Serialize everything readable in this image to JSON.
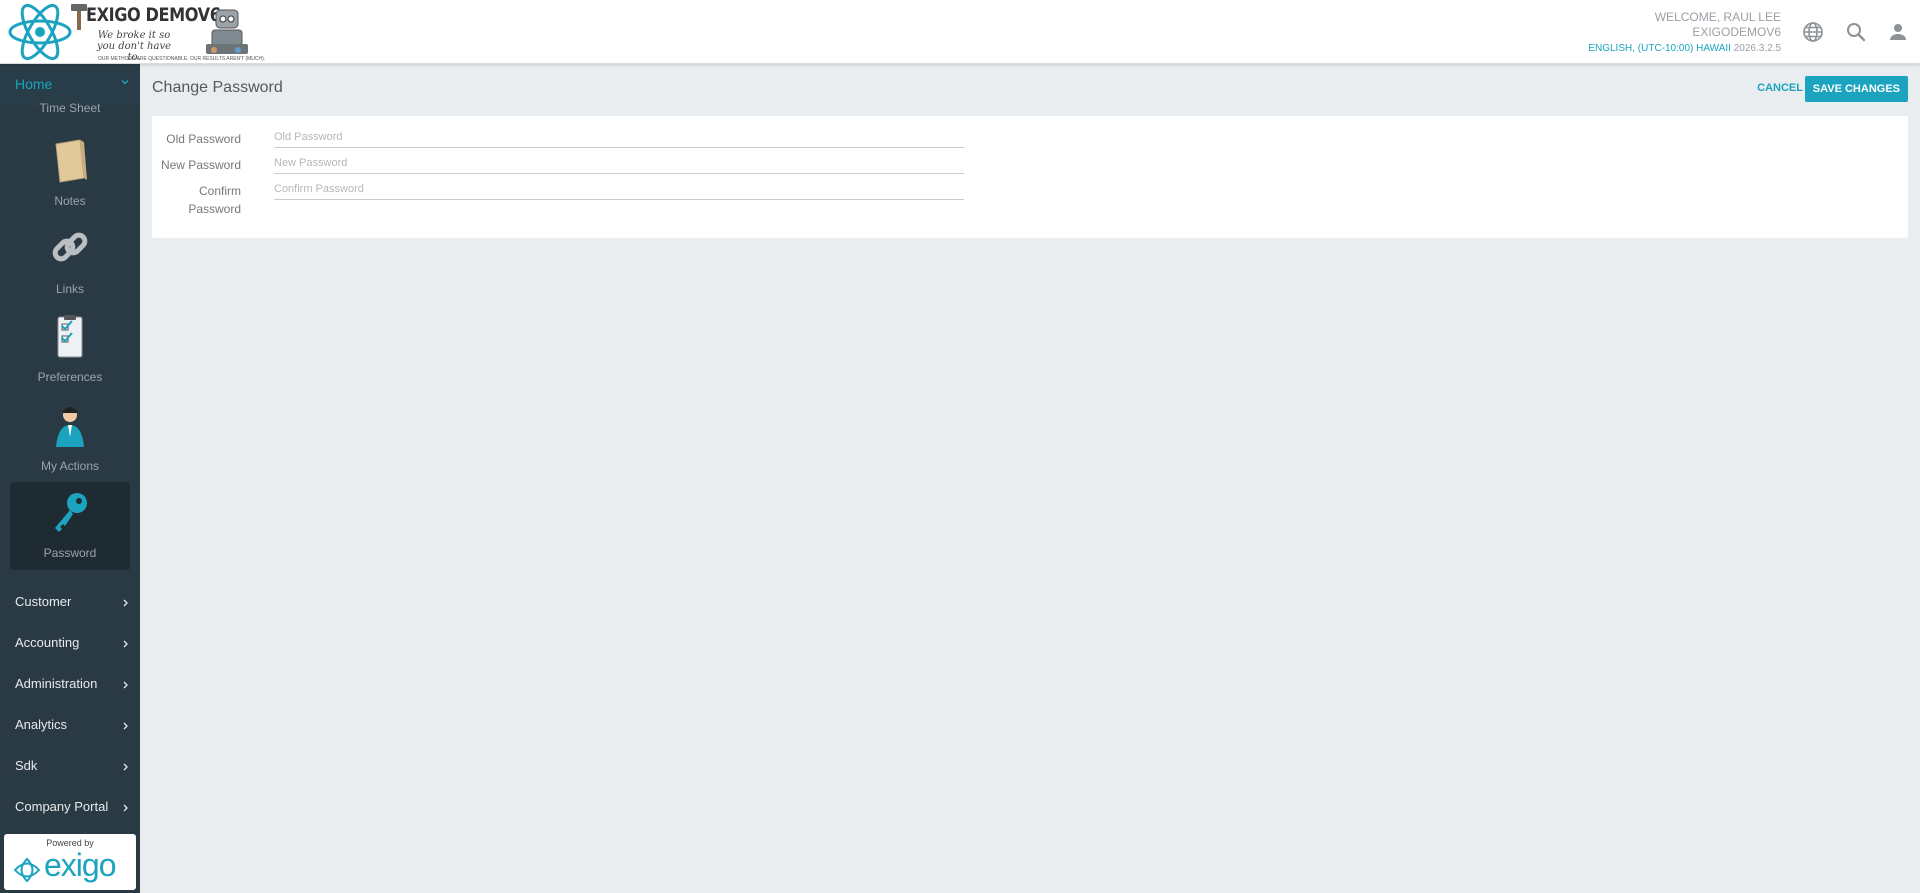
{
  "header": {
    "logo_title": "EXIGO DEMOV6",
    "logo_tagline": "We broke it so you don't have to.",
    "logo_fine_print": "OUR METHODS ARE QUESTIONABLE. OUR RESULTS AREN'T (MUCH).",
    "welcome": "WELCOME, RAUL LEE",
    "company": "EXIGODEMOV6",
    "locale": "ENGLISH, (UTC-10:00) HAWAII",
    "version": "2026.3.2.5",
    "icons": [
      "globe-icon",
      "search-icon",
      "user-icon"
    ]
  },
  "sidebar": {
    "home_label": "Home",
    "partial_caption": "Time Sheet",
    "apps": [
      {
        "label": "Notes",
        "icon": "notes-icon"
      },
      {
        "label": "Links",
        "icon": "links-icon"
      },
      {
        "label": "Preferences",
        "icon": "preferences-icon"
      },
      {
        "label": "My Actions",
        "icon": "my-actions-icon"
      },
      {
        "label": "Password",
        "icon": "key-icon",
        "active": true
      }
    ],
    "nav": [
      {
        "label": "Customer"
      },
      {
        "label": "Accounting"
      },
      {
        "label": "Administration"
      },
      {
        "label": "Analytics"
      },
      {
        "label": "Sdk"
      },
      {
        "label": "Company Portal"
      }
    ],
    "powered_by": "Powered by",
    "brand": "exigo"
  },
  "main": {
    "title": "Change Password",
    "cancel_label": "CANCEL",
    "save_label": "SAVE CHANGES",
    "fields": [
      {
        "label": "Old Password",
        "placeholder": "Old Password",
        "value": ""
      },
      {
        "label": "New Password",
        "placeholder": "New Password",
        "value": ""
      },
      {
        "label": "Confirm Password",
        "placeholder": "Confirm Password",
        "value": ""
      }
    ]
  },
  "colors": {
    "accent": "#1ba3bf",
    "sidebar_bg": "#2a3a44",
    "page_bg": "#e9edf0"
  }
}
